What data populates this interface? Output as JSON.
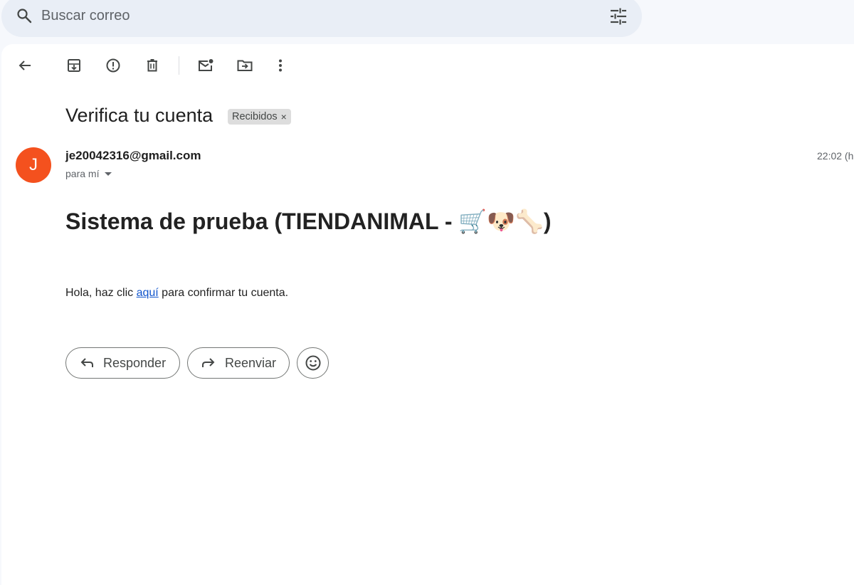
{
  "search": {
    "placeholder": "Buscar correo",
    "icon": "search-icon",
    "filter_icon": "tune-icon"
  },
  "toolbar": {
    "icons": [
      "back-arrow-icon",
      "archive-icon",
      "report-spam-icon",
      "delete-icon",
      "mark-unread-icon",
      "move-to-icon",
      "more-vert-icon"
    ]
  },
  "message": {
    "subject": "Verifica tu cuenta",
    "label": "Recibidos",
    "label_remove": "×",
    "sender_initial": "J",
    "sender_email": "je20042316@gmail.com",
    "recipient": "para mí",
    "time": "22:02 (h",
    "avatar_color": "#f4511e"
  },
  "body": {
    "heading_text": "Sistema de prueba (TIENDANIMAL - ",
    "heading_emojis": "🛒🐶🦴",
    "heading_close": ")",
    "text_before": "Hola, haz clic ",
    "link_text": "aquí",
    "text_after": " para confirmar tu cuenta."
  },
  "actions": {
    "reply_label": "Responder",
    "forward_label": "Reenviar",
    "emoji_icon": "smiley-icon"
  },
  "colors": {
    "link": "#1155cc",
    "search_bg": "#e9eef6",
    "page_bg": "#f6f8fc"
  }
}
